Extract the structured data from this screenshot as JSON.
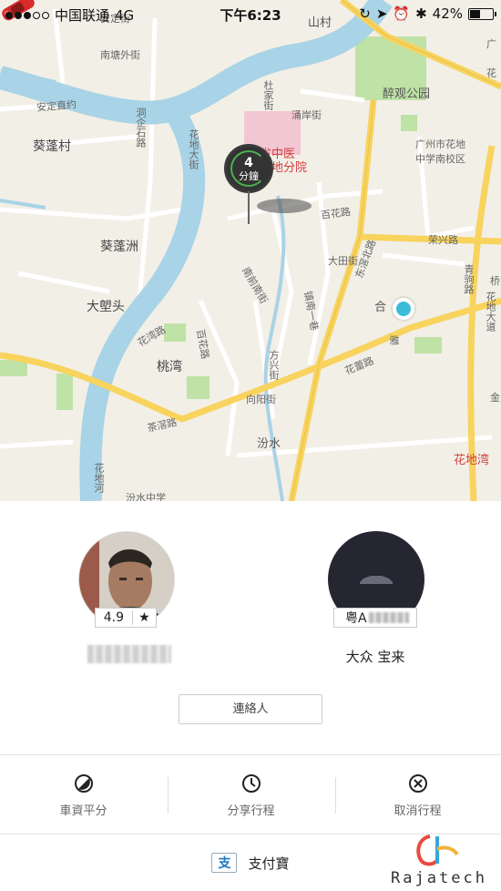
{
  "status_bar": {
    "carrier": "中国联通",
    "network": "4G",
    "time": "下午6:23",
    "battery": "42%",
    "icons": [
      "signal-dots-icon",
      "lock-rotation-icon",
      "location-arrow-icon",
      "alarm-icon",
      "bluetooth-icon",
      "battery-icon"
    ]
  },
  "map": {
    "labels": {
      "shancun": "山村",
      "nanqiao": "南塘外街",
      "anding_top": "安定街",
      "anding_road": "安定直约",
      "kuipeng": "葵蓬村",
      "dongkou": "洞企石路",
      "huadi": "花地大街",
      "dushe": "杜家街",
      "hospital": "省中医",
      "hospital2": "花地分院",
      "yongan": "涌岸街",
      "zuiguan": "醉观公园",
      "school": "广州市花地",
      "school2": "中学南校区",
      "baihua": "百花路",
      "kuipengzhou": "葵蓬洲",
      "rongxing": "荣兴路",
      "datian": "大田街",
      "dachongtou": "大塱头",
      "nanqian": "南前南街",
      "zhennanyi": "镇南一巷",
      "dongjiao": "东滘北路",
      "huawan": "花湾路",
      "baihua2": "百花路",
      "taowan": "桃湾",
      "fangxing": "方兴街",
      "hewei": "合",
      "huaxu": "花蕾路",
      "caowan": "茶滘路",
      "xiangyang": "向阳街",
      "fenshui": "汾水",
      "huadi_river": "花地河",
      "fenshui_school": "汾水中学",
      "huadiwan": "花地湾",
      "guang": "广",
      "hua": "花",
      "qiao": "桥",
      "jin": "金",
      "ya": "雅",
      "huadi_ave": "花地大道",
      "qinghao": "青驹路"
    },
    "eta": {
      "number": "4",
      "unit": "分鐘"
    }
  },
  "driver": {
    "rating": "4.9",
    "rating_icon": "star-icon",
    "car_model": "大众 宝来",
    "plate_prefix": "粤A"
  },
  "contact_button": "連絡人",
  "actions": [
    {
      "label": "車資平分",
      "icon": "split-fare-icon"
    },
    {
      "label": "分享行程",
      "icon": "clock-icon"
    },
    {
      "label": "取消行程",
      "icon": "cancel-icon"
    }
  ],
  "payment": {
    "label": "支付寶",
    "icon": "alipay-icon",
    "icon_glyph": "支"
  },
  "watermark": {
    "text": "Rajatech"
  },
  "colors": {
    "water": "#a9d3e6",
    "road_major": "#f8d35e",
    "park": "#bfe2a6",
    "location": "#3bbcd8",
    "car": "#d92b2b"
  }
}
